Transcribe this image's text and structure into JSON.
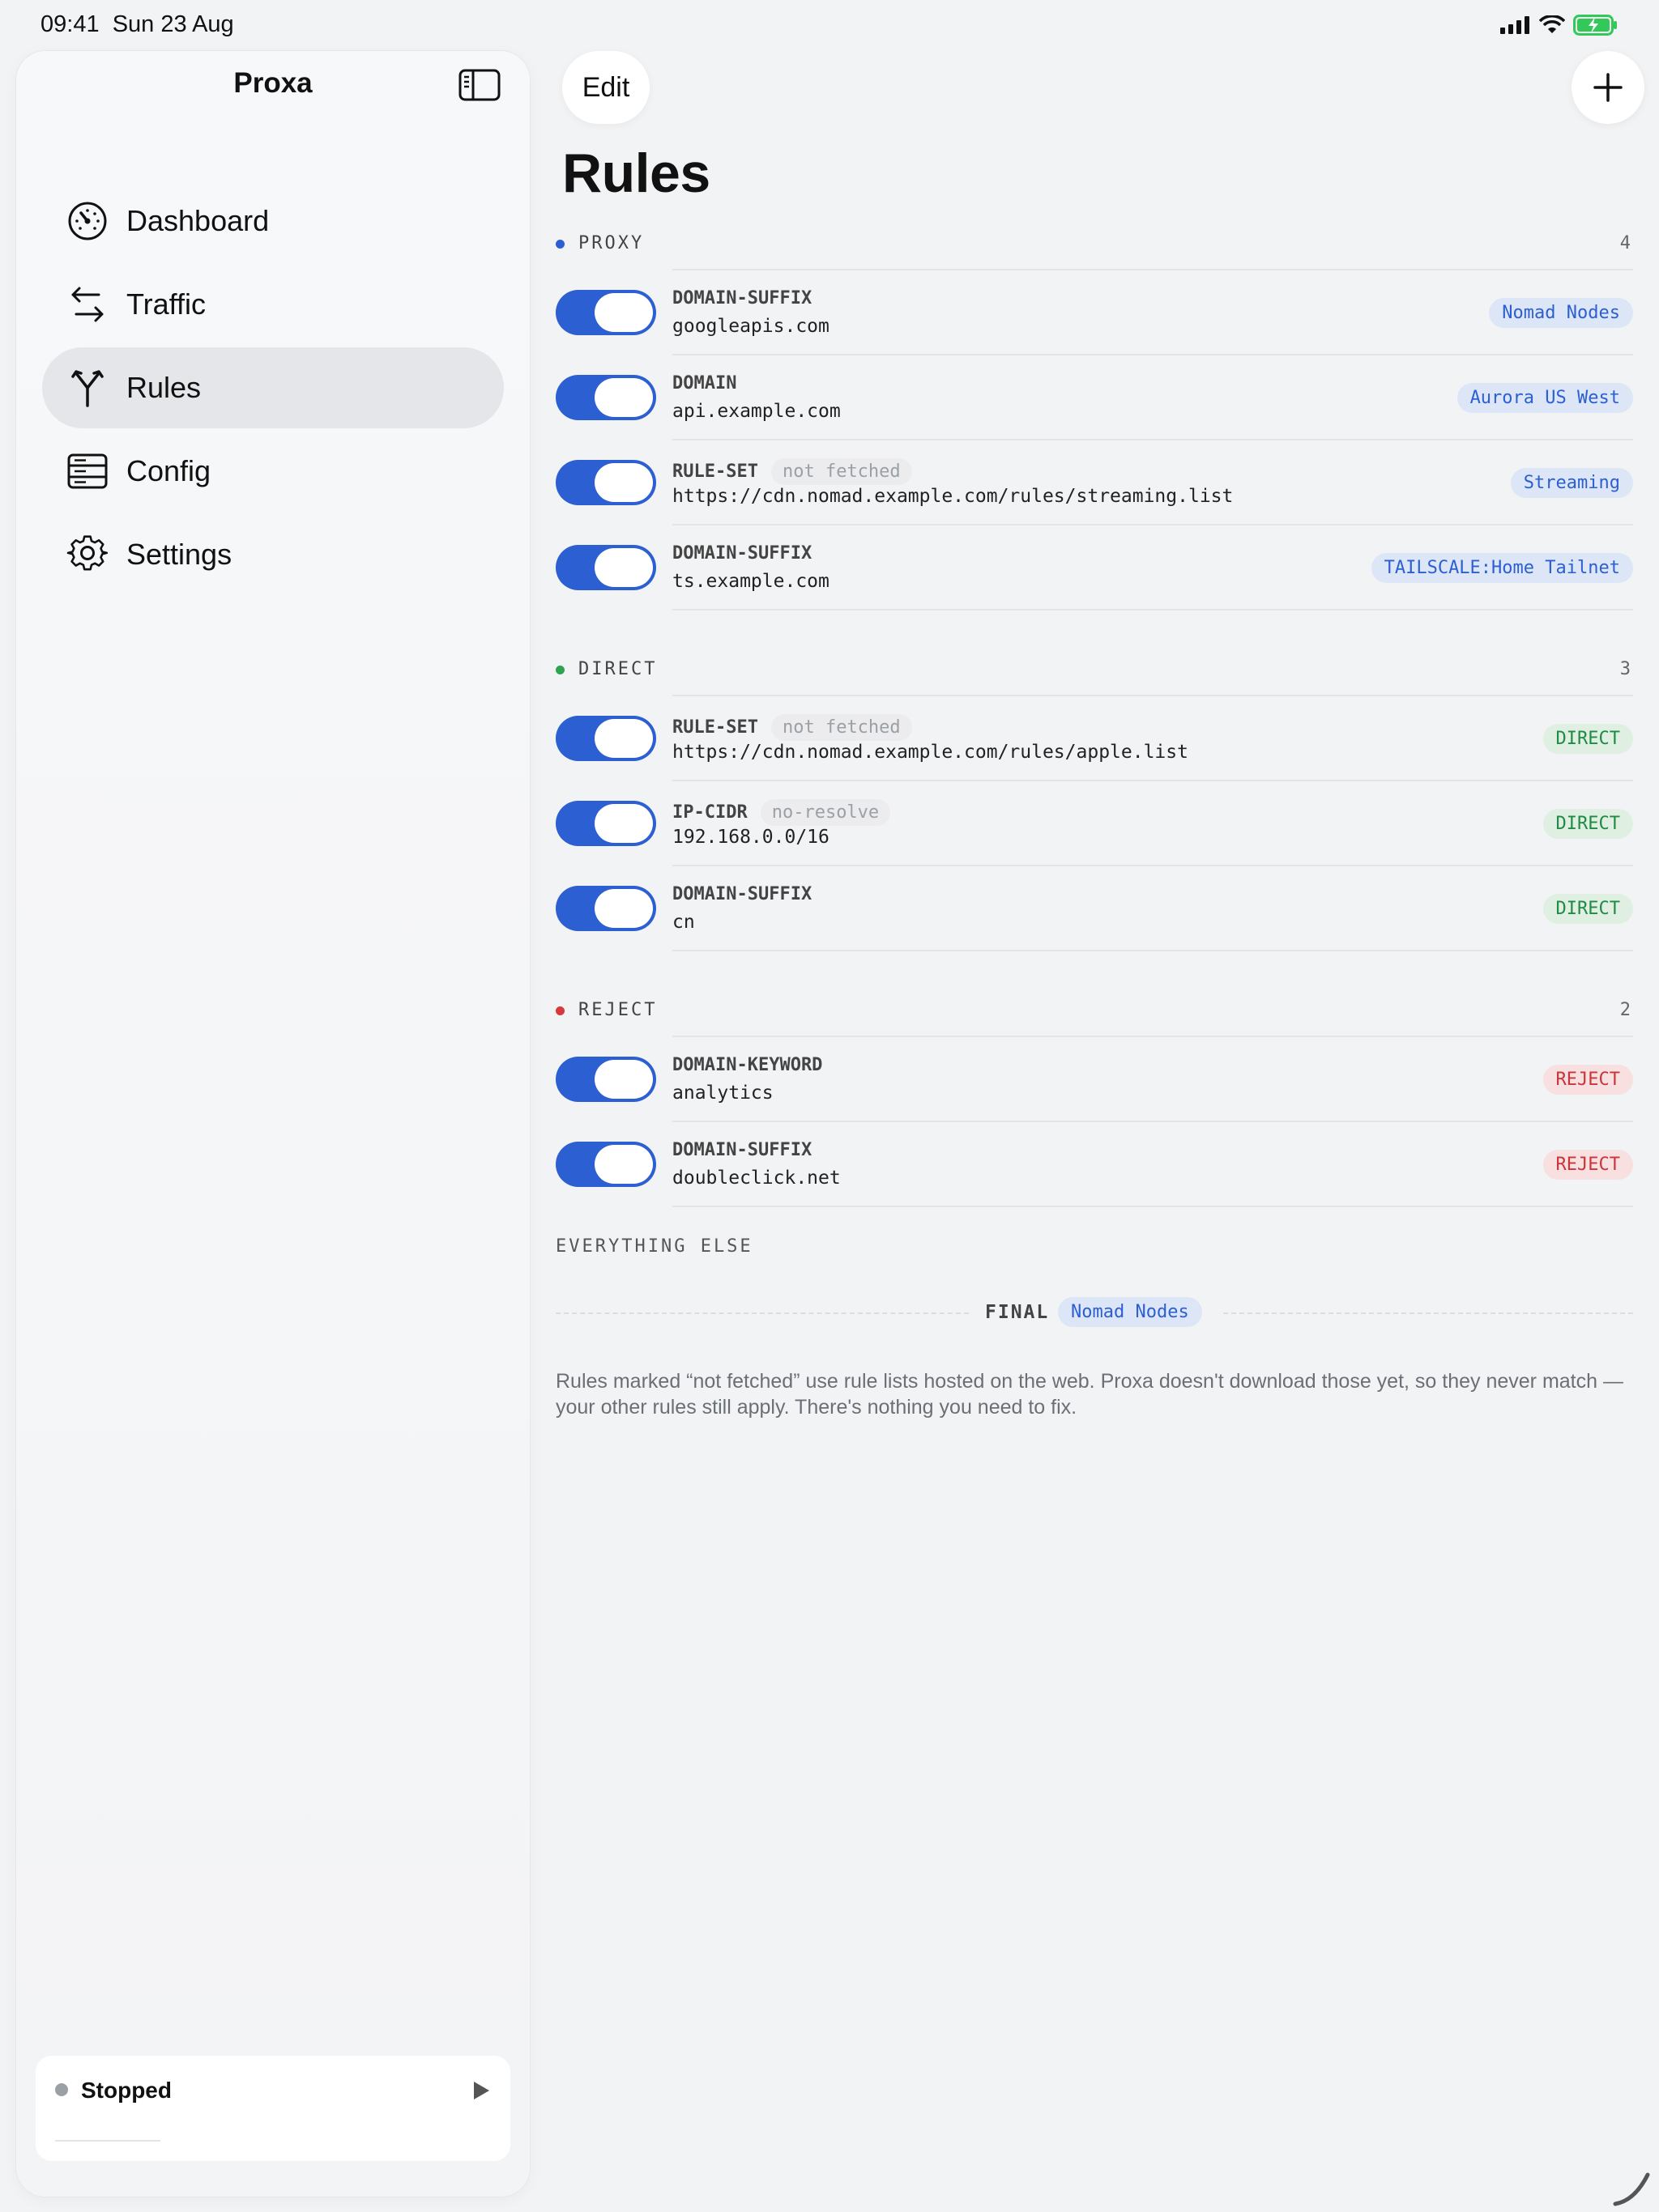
{
  "status_bar": {
    "time": "09:41",
    "date": "Sun 23 Aug"
  },
  "sidebar": {
    "title": "Proxa",
    "items": [
      {
        "label": "Dashboard",
        "icon": "gauge-icon"
      },
      {
        "label": "Traffic",
        "icon": "arrows-left-right-icon"
      },
      {
        "label": "Rules",
        "icon": "fork-icon",
        "active": true
      },
      {
        "label": "Config",
        "icon": "server-icon"
      },
      {
        "label": "Settings",
        "icon": "gear-icon"
      }
    ],
    "status": {
      "label": "Stopped"
    }
  },
  "toolbar": {
    "edit_label": "Edit"
  },
  "page": {
    "title": "Rules"
  },
  "sections": [
    {
      "name": "PROXY",
      "count": "4",
      "color": "#2c5fd1",
      "rules": [
        {
          "type": "DOMAIN-SUFFIX",
          "value": "googleapis.com",
          "target": "Nomad Nodes",
          "badge": "blue"
        },
        {
          "type": "DOMAIN",
          "value": "api.example.com",
          "target": "Aurora US West",
          "badge": "blue"
        },
        {
          "type": "RULE-SET",
          "tag": "not fetched",
          "value": "https://cdn.nomad.example.com/rules/streaming.list",
          "target": "Streaming",
          "badge": "blue"
        },
        {
          "type": "DOMAIN-SUFFIX",
          "value": "ts.example.com",
          "target": "TAILSCALE:Home Tailnet",
          "badge": "blue"
        }
      ]
    },
    {
      "name": "DIRECT",
      "count": "3",
      "color": "#2ea44f",
      "rules": [
        {
          "type": "RULE-SET",
          "tag": "not fetched",
          "value": "https://cdn.nomad.example.com/rules/apple.list",
          "target": "DIRECT",
          "badge": "green"
        },
        {
          "type": "IP-CIDR",
          "tag": "no-resolve",
          "value": "192.168.0.0/16",
          "target": "DIRECT",
          "badge": "green"
        },
        {
          "type": "DOMAIN-SUFFIX",
          "value": "cn",
          "target": "DIRECT",
          "badge": "green"
        }
      ]
    },
    {
      "name": "REJECT",
      "count": "2",
      "color": "#d7393d",
      "rules": [
        {
          "type": "DOMAIN-KEYWORD",
          "value": "analytics",
          "target": "REJECT",
          "badge": "red"
        },
        {
          "type": "DOMAIN-SUFFIX",
          "value": "doubleclick.net",
          "target": "REJECT",
          "badge": "red"
        }
      ]
    }
  ],
  "everything_else": {
    "heading": "EVERYTHING ELSE",
    "final_label": "FINAL",
    "final_target": "Nomad Nodes"
  },
  "note": "Rules marked “not fetched” use rule lists hosted on the web. Proxa doesn't download those yet, so they never match — your other rules still apply. There's nothing you need to fix."
}
